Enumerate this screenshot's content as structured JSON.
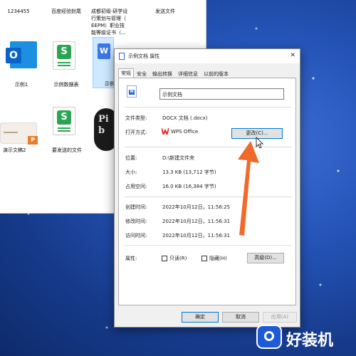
{
  "explorer": {
    "top_labels": [
      "1234455",
      "百度经验封尾",
      "成都初级·研学设\n行策划与管理（\nEEPM）职业技\n能等级证书（...",
      "发送文件"
    ],
    "files": [
      {
        "label": "示例1",
        "icon": "outlook-icon",
        "color": "#0a64c8"
      },
      {
        "label": "示例数据表",
        "icon": "wps-spreadsheet-icon",
        "color": "#2aa552"
      },
      {
        "label": "示例",
        "icon": "wps-document-icon",
        "color": "#3b78e7"
      },
      {
        "label": "演示文稿2",
        "icon": "presentation-thumbnail-icon",
        "color": "#e87d2f"
      },
      {
        "label": "要发送的文件",
        "icon": "wps-spreadsheet-icon",
        "color": "#2aa552"
      }
    ],
    "thumb_text": "Pi\nb"
  },
  "dialog": {
    "title": "示例文档 属性",
    "close_glyph": "✕",
    "tabs": [
      "常规",
      "安全",
      "输出转换",
      "详细信息",
      "以前的版本"
    ],
    "active_tab": "常规",
    "filename": "示例文档",
    "rows": {
      "type_label": "文件类型:",
      "type_value": "DOCX 文档 (.docx)",
      "open_label": "打开方式:",
      "open_value": "WPS Office",
      "change_button": "更改(C)...",
      "location_label": "位置:",
      "location_value": "D:\\新建文件夹",
      "size_label": "大小:",
      "size_value": "13.3 KB (13,712 字节)",
      "disk_label": "占用空间:",
      "disk_value": "16.0 KB (16,384 字节)",
      "created_label": "创建时间:",
      "created_value": "2022年10月12日，11:56:25",
      "modified_label": "修改时间:",
      "modified_value": "2022年10月12日，11:56:31",
      "accessed_label": "访问时间:",
      "accessed_value": "2022年10月12日，11:56:31",
      "attr_label": "属性:",
      "readonly_label": "只读(R)",
      "hidden_label": "隐藏(H)",
      "advanced_button": "高级(D)..."
    },
    "footer": {
      "ok": "确定",
      "cancel": "取消",
      "apply": "应用(A)"
    }
  },
  "watermark": {
    "text": "好装机"
  },
  "colors": {
    "arrow": "#f06a2a",
    "wps_red": "#e2231a",
    "word_blue": "#2b63d9"
  }
}
